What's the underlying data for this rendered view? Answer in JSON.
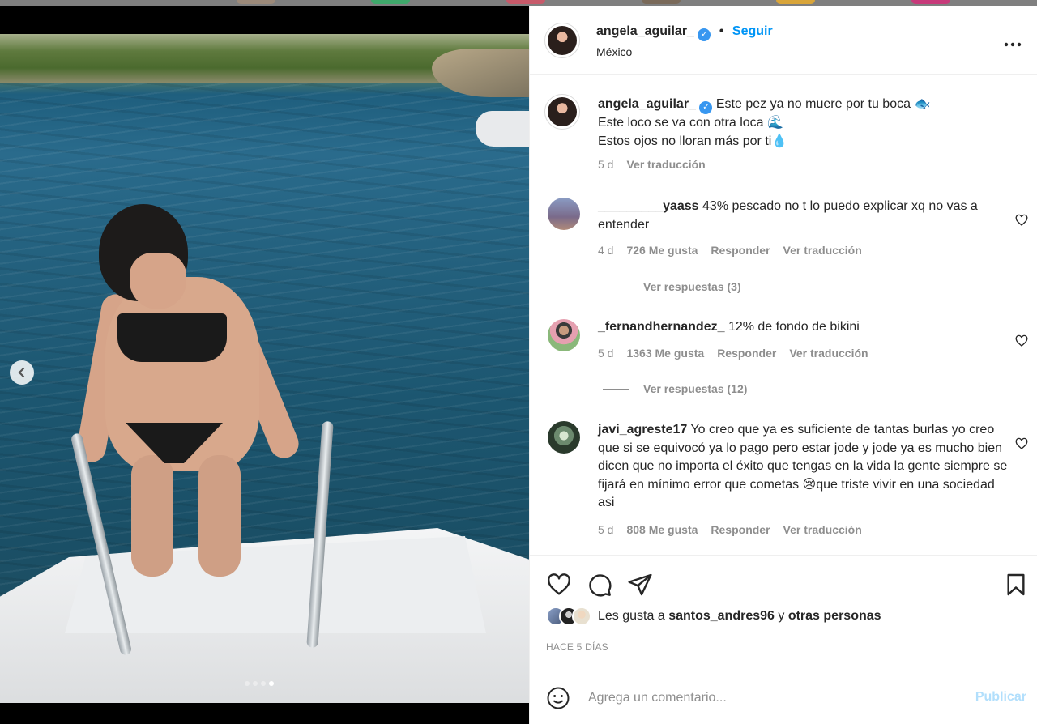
{
  "post": {
    "username": "angela_aguilar_",
    "follow_label": "Seguir",
    "separator": "•",
    "location": "México",
    "more_icon": "more-horizontal-icon"
  },
  "caption": {
    "username": "angela_aguilar_",
    "lines": [
      "Este pez ya no muere por tu boca 🐟",
      "Este loco se va con otra loca 🌊",
      "Estos ojos no lloran más por ti💧"
    ],
    "age": "5 d",
    "translate": "Ver traducción"
  },
  "comments": [
    {
      "username": "_________yaass",
      "text": "43% pescado no t lo puedo explicar xq no vas a entender",
      "age": "4 d",
      "likes": "726 Me gusta",
      "reply": "Responder",
      "translate": "Ver traducción",
      "replies": "Ver respuestas (3)"
    },
    {
      "username": "_fernandhernandez_",
      "text": "12% de fondo de bikini",
      "age": "5 d",
      "likes": "1363 Me gusta",
      "reply": "Responder",
      "translate": "Ver traducción",
      "replies": "Ver respuestas (12)"
    },
    {
      "username": "javi_agreste17",
      "text": "Yo creo que ya es suficiente de tantas burlas yo creo que si se equivocó ya lo pago pero estar jode y jode ya es mucho bien dicen que no importa el éxito que tengas en la vida la gente siempre se fijará en mínimo error que cometas 😢que triste vivir en una sociedad asi",
      "age": "5 d",
      "likes": "808 Me gusta",
      "reply": "Responder",
      "translate": "Ver traducción"
    }
  ],
  "likes": {
    "prefix": "Les gusta a",
    "user": "santos_andres96",
    "joiner": "y",
    "others": "otras personas"
  },
  "date": "HACE 5 DÍAS",
  "composer": {
    "placeholder": "Agrega un comentario...",
    "publish": "Publicar"
  },
  "carousel": {
    "count": 4,
    "active_index": 3
  },
  "colors": {
    "accent": "#0095f6",
    "verified": "#3897f0",
    "muted": "#8e8e8e",
    "publish_disabled": "#b2dffc"
  }
}
